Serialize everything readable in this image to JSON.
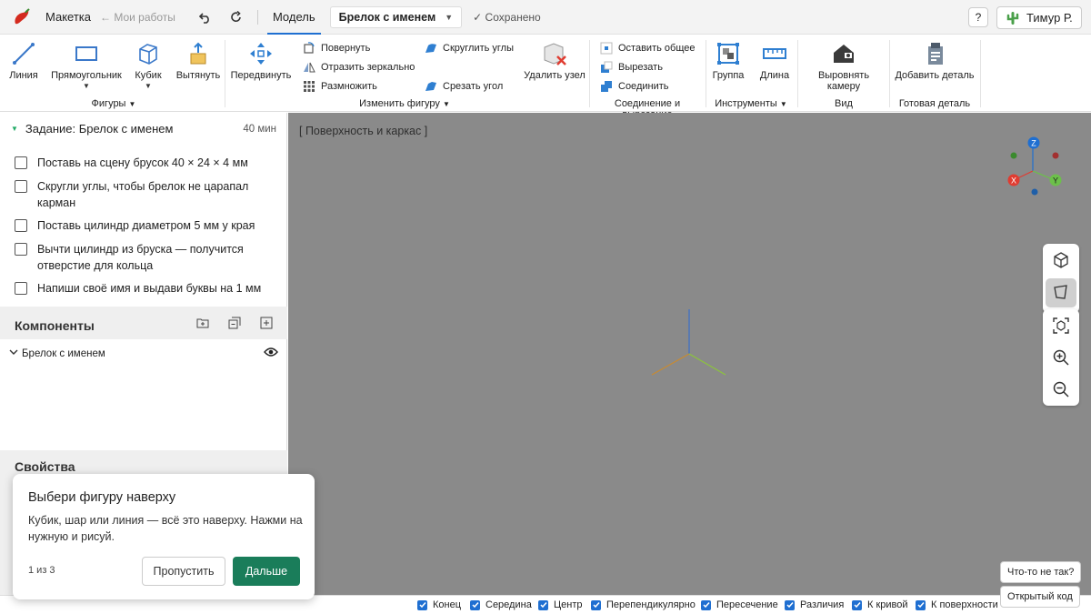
{
  "topbar": {
    "app_title": "Макетка",
    "back_link": "← Мои работы",
    "tab_model": "Модель",
    "doc_name": "Брелок с именем",
    "saved": "✓ Сохранено",
    "help": "?",
    "user_name": "Тимур Р."
  },
  "ribbon": {
    "shapes": {
      "line": "Линия",
      "rectangle": "Прямоугольник",
      "cube": "Кубик",
      "extrude": "Вытянуть",
      "group_label": "Фигуры"
    },
    "modify": {
      "move": "Передвинуть",
      "rotate": "Повернуть",
      "mirror": "Отразить зеркально",
      "multiply": "Размножить",
      "round_corners": "Скруглить углы",
      "chamfer": "Срезать угол",
      "delete_node": "Удалить узел",
      "group_label": "Изменить фигуру"
    },
    "boolean": {
      "intersect": "Оставить общее",
      "subtract": "Вырезать",
      "union": "Соединить",
      "group_label": "Соединение и вырезание"
    },
    "tools": {
      "group": "Группа",
      "length": "Длина",
      "group_label": "Инструменты"
    },
    "view": {
      "align_camera": "Выровнять камеру",
      "group_label": "Вид"
    },
    "ready": {
      "add_part": "Добавить деталь",
      "group_label": "Готовая деталь"
    }
  },
  "task": {
    "title": "Задание: Брелок с именем",
    "time": "40 мин",
    "items": [
      "Поставь на сцену брусок 40 × 24 × 4 мм",
      "Скругли углы, чтобы брелок не царапал карман",
      "Поставь цилиндр диаметром 5 мм у края",
      "Вычти цилиндр из бруска — получится отверстие для кольца",
      "Напиши своё имя и выдави буквы на 1 мм"
    ]
  },
  "components": {
    "title": "Компоненты",
    "root_item": "Брелок с именем"
  },
  "properties": {
    "title": "Свойства"
  },
  "viewport": {
    "mode_label": "[ Поверхность и каркас ]",
    "axes": {
      "x": "X",
      "y": "Y",
      "z": "Z"
    }
  },
  "feedback": {
    "report": "Что-то не так?",
    "open_code": "Открытый код"
  },
  "statusbar": {
    "hint": "",
    "snaps": [
      "Конец",
      "Середина",
      "Центр",
      "Перепендикулярно",
      "Пересечение",
      "Различия",
      "К кривой",
      "К поверхности"
    ]
  },
  "tour": {
    "title": "Выбери фигуру наверху",
    "body": "Кубик, шар или линия — всё это наверху. Нажми на нужную и рисуй.",
    "step": "1 из 3",
    "skip": "Пропустить",
    "next": "Дальше"
  },
  "colors": {
    "accent": "#1f6fd1",
    "primary_button": "#1a7d5a",
    "viewport_bg": "#8a8a8a",
    "axis_x": "#e03c31",
    "axis_y": "#6cc04a",
    "axis_z": "#1f6fd1"
  }
}
